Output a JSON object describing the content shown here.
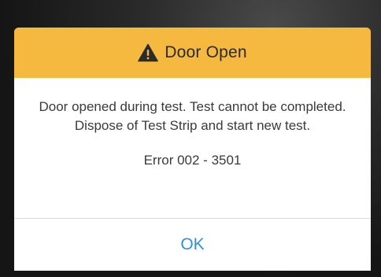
{
  "dialog": {
    "icon": "warning-triangle-icon",
    "title": "Door Open",
    "message": "Door opened during test. Test cannot be completed. Dispose of Test Strip and start new test.",
    "error_code": "Error 002 - 3501",
    "ok_label": "OK"
  },
  "colors": {
    "header_background": "#f4b93e",
    "button_text": "#2f8fd8",
    "body_text": "#3a3a3a"
  }
}
